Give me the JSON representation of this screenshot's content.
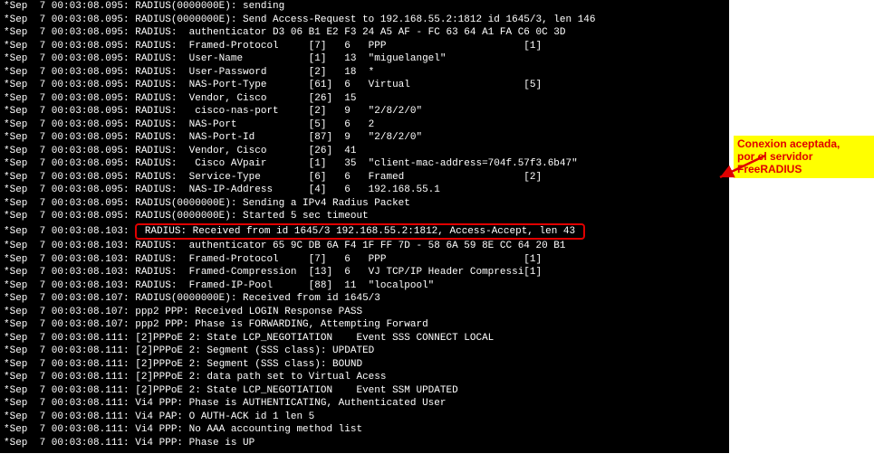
{
  "callout": {
    "line1": "Conexion aceptada,",
    "line2": "por el servidor FreeRADIUS"
  },
  "lines": [
    "*Sep  7 00:03:08.095: RADIUS(0000000E): sending",
    "*Sep  7 00:03:08.095: RADIUS(0000000E): Send Access-Request to 192.168.55.2:1812 id 1645/3, len 146",
    "*Sep  7 00:03:08.095: RADIUS:  authenticator D3 06 B1 E2 F3 24 A5 AF - FC 63 64 A1 FA C6 0C 3D",
    "*Sep  7 00:03:08.095: RADIUS:  Framed-Protocol     [7]   6   PPP                       [1]",
    "*Sep  7 00:03:08.095: RADIUS:  User-Name           [1]   13  \"miguelangel\"",
    "*Sep  7 00:03:08.095: RADIUS:  User-Password       [2]   18  *",
    "*Sep  7 00:03:08.095: RADIUS:  NAS-Port-Type       [61]  6   Virtual                   [5]",
    "*Sep  7 00:03:08.095: RADIUS:  Vendor, Cisco       [26]  15",
    "*Sep  7 00:03:08.095: RADIUS:   cisco-nas-port     [2]   9   \"2/8/2/0\"",
    "*Sep  7 00:03:08.095: RADIUS:  NAS-Port            [5]   6   2",
    "*Sep  7 00:03:08.095: RADIUS:  NAS-Port-Id         [87]  9   \"2/8/2/0\"",
    "*Sep  7 00:03:08.095: RADIUS:  Vendor, Cisco       [26]  41",
    "*Sep  7 00:03:08.095: RADIUS:   Cisco AVpair       [1]   35  \"client-mac-address=704f.57f3.6b47\"",
    "*Sep  7 00:03:08.095: RADIUS:  Service-Type        [6]   6   Framed                    [2]",
    "*Sep  7 00:03:08.095: RADIUS:  NAS-IP-Address      [4]   6   192.168.55.1",
    "*Sep  7 00:03:08.095: RADIUS(0000000E): Sending a IPv4 Radius Packet",
    "*Sep  7 00:03:08.095: RADIUS(0000000E): Started 5 sec timeout",
    "*Sep  7 00:03:08.103: RADIUS: Received from id 1645/3 192.168.55.2:1812, Access-Accept, len 43",
    "*Sep  7 00:03:08.103: RADIUS:  authenticator 65 9C DB 6A F4 1F FF 7D - 58 6A 59 8E CC 64 20 B1",
    "*Sep  7 00:03:08.103: RADIUS:  Framed-Protocol     [7]   6   PPP                       [1]",
    "*Sep  7 00:03:08.103: RADIUS:  Framed-Compression  [13]  6   VJ TCP/IP Header Compressi[1]",
    "*Sep  7 00:03:08.103: RADIUS:  Framed-IP-Pool      [88]  11  \"localpool\"",
    "*Sep  7 00:03:08.107: RADIUS(0000000E): Received from id 1645/3",
    "*Sep  7 00:03:08.107: ppp2 PPP: Received LOGIN Response PASS",
    "*Sep  7 00:03:08.107: ppp2 PPP: Phase is FORWARDING, Attempting Forward",
    "*Sep  7 00:03:08.111: [2]PPPoE 2: State LCP_NEGOTIATION    Event SSS CONNECT LOCAL",
    "*Sep  7 00:03:08.111: [2]PPPoE 2: Segment (SSS class): UPDATED",
    "*Sep  7 00:03:08.111: [2]PPPoE 2: Segment (SSS class): BOUND",
    "*Sep  7 00:03:08.111: [2]PPPoE 2: data path set to Virtual Acess",
    "*Sep  7 00:03:08.111: [2]PPPoE 2: State LCP_NEGOTIATION    Event SSM UPDATED",
    "*Sep  7 00:03:08.111: Vi4 PPP: Phase is AUTHENTICATING, Authenticated User",
    "*Sep  7 00:03:08.111: Vi4 PAP: O AUTH-ACK id 1 len 5",
    "*Sep  7 00:03:08.111: Vi4 PPP: No AAA accounting method list",
    "*Sep  7 00:03:08.111: Vi4 PPP: Phase is UP"
  ],
  "highlight_index": 17
}
